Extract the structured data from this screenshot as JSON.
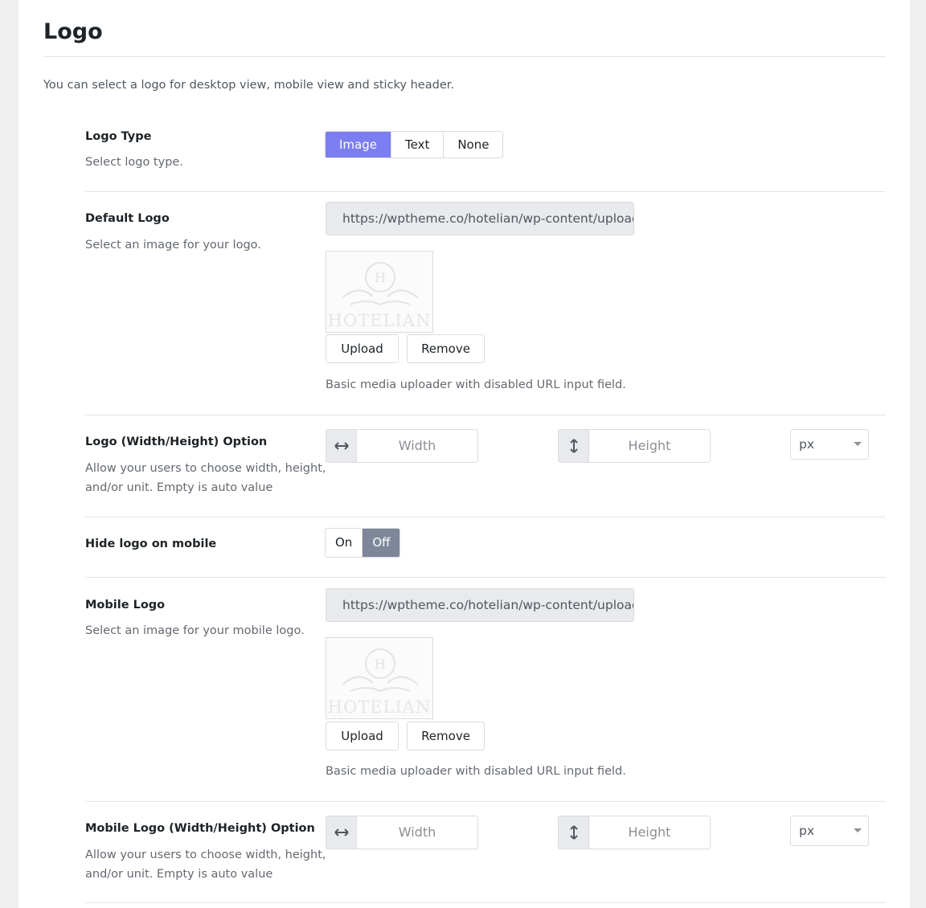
{
  "section": {
    "title": "Logo",
    "intro": "You can select a logo for desktop view, mobile view and sticky header."
  },
  "logo_type": {
    "label": "Logo Type",
    "desc": "Select logo type.",
    "options": [
      "Image",
      "Text",
      "None"
    ],
    "selected": "Image"
  },
  "default_logo": {
    "label": "Default Logo",
    "desc": "Select an image for your logo.",
    "url": "https://wptheme.co/hotelian/wp-content/uploads/",
    "thumb_text": "HOTELIAN",
    "upload_label": "Upload",
    "remove_label": "Remove",
    "help": "Basic media uploader with disabled URL input field."
  },
  "logo_dimensions": {
    "label": "Logo (Width/Height) Option",
    "desc": "Allow your users to choose width, height, and/or unit. Empty is auto value",
    "width_placeholder": "Width",
    "height_placeholder": "Height",
    "unit": "px"
  },
  "hide_mobile": {
    "label": "Hide logo on mobile",
    "on_label": "On",
    "off_label": "Off",
    "selected": "Off"
  },
  "mobile_logo": {
    "label": "Mobile Logo",
    "desc": "Select an image for your mobile logo.",
    "url": "https://wptheme.co/hotelian/wp-content/uploads/",
    "thumb_text": "HOTELIAN",
    "upload_label": "Upload",
    "remove_label": "Remove",
    "help": "Basic media uploader with disabled URL input field."
  },
  "mobile_logo_dimensions": {
    "label": "Mobile Logo (Width/Height) Option",
    "desc": "Allow your users to choose width, height, and/or unit. Empty is auto value",
    "width_placeholder": "Width",
    "height_placeholder": "Height",
    "unit": "px"
  },
  "colors": {
    "accent": "#7b7ef0",
    "toggle_active": "#7d8799"
  }
}
